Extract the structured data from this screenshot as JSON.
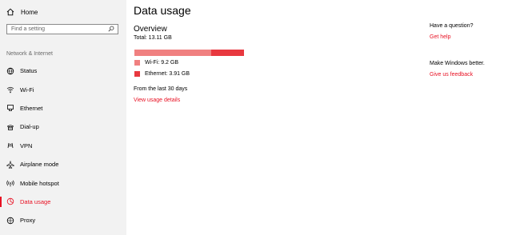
{
  "sidebar": {
    "home_label": "Home",
    "search_placeholder": "Find a setting",
    "section_header": "Network & Internet",
    "items": [
      {
        "label": "Status"
      },
      {
        "label": "Wi-Fi"
      },
      {
        "label": "Ethernet"
      },
      {
        "label": "Dial-up"
      },
      {
        "label": "VPN"
      },
      {
        "label": "Airplane mode"
      },
      {
        "label": "Mobile hotspot"
      },
      {
        "label": "Data usage",
        "active": true
      },
      {
        "label": "Proxy"
      }
    ]
  },
  "main": {
    "title": "Data usage",
    "overview": {
      "heading": "Overview",
      "total": "Total: 13.11 GB",
      "wifi": {
        "label": "Wi-Fi: 9.2 GB",
        "gb": 9.2,
        "color": "#f08080"
      },
      "ethernet": {
        "label": "Ethernet: 3.91 GB",
        "gb": 3.91,
        "color": "#e8383f"
      }
    },
    "period": "From the last 30 days",
    "details_link": "View usage details"
  },
  "right_panel": {
    "question": "Have a question?",
    "help_link": "Get help",
    "better": "Make Windows better.",
    "feedback_link": "Give us feedback"
  },
  "colors": {
    "accent": "#e81123",
    "sidebar_bg": "#f2f2f2"
  }
}
